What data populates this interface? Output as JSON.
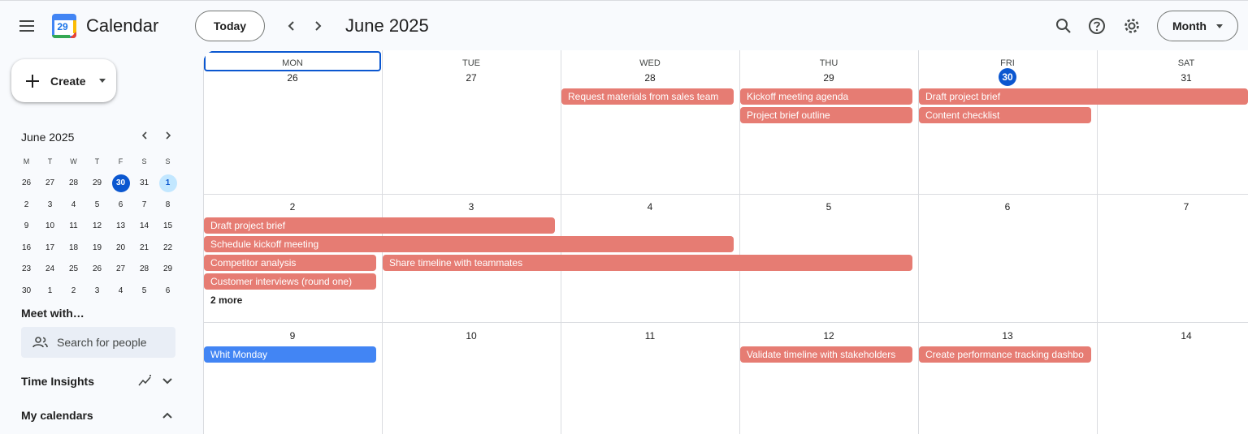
{
  "header": {
    "app_title": "Calendar",
    "logo_number": "29",
    "today_label": "Today",
    "date_title": "June 2025",
    "view_label": "Month"
  },
  "sidebar": {
    "create_label": "Create",
    "mini_calendar": {
      "title": "June 2025",
      "weekdays": [
        "M",
        "T",
        "W",
        "T",
        "F",
        "S",
        "S"
      ],
      "weeks": [
        [
          "26",
          "27",
          "28",
          "29",
          "30",
          "31",
          "1"
        ],
        [
          "2",
          "3",
          "4",
          "5",
          "6",
          "7",
          "8"
        ],
        [
          "9",
          "10",
          "11",
          "12",
          "13",
          "14",
          "15"
        ],
        [
          "16",
          "17",
          "18",
          "19",
          "20",
          "21",
          "22"
        ],
        [
          "23",
          "24",
          "25",
          "26",
          "27",
          "28",
          "29"
        ],
        [
          "30",
          "1",
          "2",
          "3",
          "4",
          "5",
          "6"
        ]
      ],
      "selected": "30",
      "highlighted": "1"
    },
    "meet_title": "Meet with…",
    "search_people_placeholder": "Search for people",
    "time_insights": "Time Insights",
    "my_calendars": "My calendars"
  },
  "calendar": {
    "days_of_week": [
      "MON",
      "TUE",
      "WED",
      "THU",
      "FRI",
      "SAT"
    ],
    "weeks": [
      [
        "26",
        "27",
        "28",
        "29",
        "30",
        "31"
      ],
      [
        "2",
        "3",
        "4",
        "5",
        "6",
        "7"
      ],
      [
        "9",
        "10",
        "11",
        "12",
        "13",
        "14"
      ]
    ],
    "events": {
      "w1_request": "Request materials from sales team",
      "w1_kickoff": "Kickoff meeting agenda",
      "w1_brief_outline": "Project brief outline",
      "w1_draft_brief": "Draft project brief",
      "w1_checklist": "Content checklist",
      "w2_draft_brief": "Draft project brief",
      "w2_schedule": "Schedule kickoff meeting",
      "w2_competitor": "Competitor analysis",
      "w2_share": "Share timeline with teammates",
      "w2_interviews": "Customer interviews (round one)",
      "w2_more": "2 more",
      "w3_whit": "Whit Monday",
      "w3_validate": "Validate timeline with stakeholders",
      "w3_dashboard": "Create performance tracking dashbo"
    }
  },
  "colors": {
    "event": "#e67c73",
    "holiday": "#4285f4",
    "accent": "#0b57d0",
    "highlight": "#c2e7ff"
  }
}
